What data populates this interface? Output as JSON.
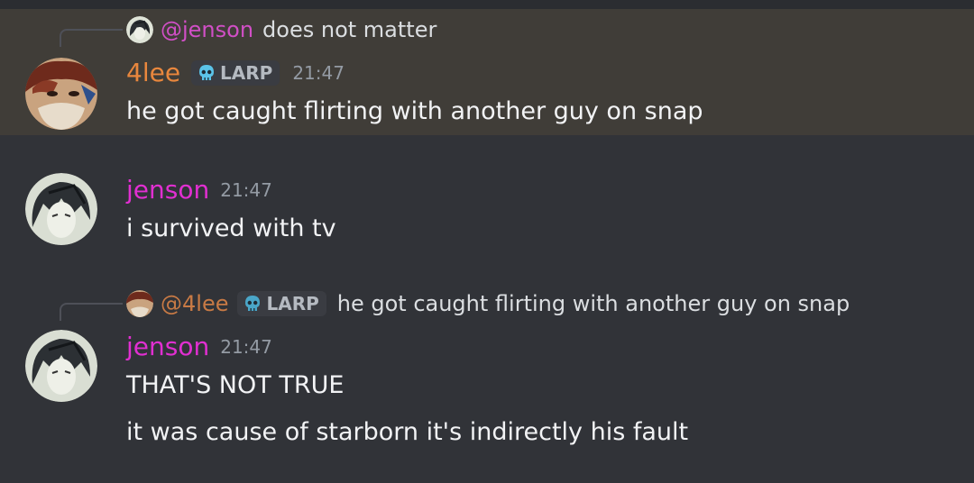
{
  "messages": [
    {
      "reply": {
        "user": "@jenson",
        "text": "does not matter"
      },
      "author": "4lee",
      "badge": "LARP",
      "time": "21:47",
      "lines": [
        "he got caught flirting with another guy on snap"
      ]
    },
    {
      "author": "jenson",
      "time": "21:47",
      "lines": [
        "i survived with tv"
      ]
    },
    {
      "reply": {
        "user": "@4lee",
        "badge": "LARP",
        "text": "he got caught flirting with another guy on snap"
      },
      "author": "jenson",
      "time": "21:47",
      "lines": [
        "THAT'S NOT TRUE",
        "it was cause of starborn it's indirectly his fault"
      ]
    }
  ],
  "colors": {
    "background": "#313338",
    "highlight": "#403d38",
    "user_4lee": "#e9873d",
    "user_jenson": "#e12fd1",
    "timestamp": "#949ba4"
  },
  "icons": {
    "badge_icon": "skull-icon"
  }
}
